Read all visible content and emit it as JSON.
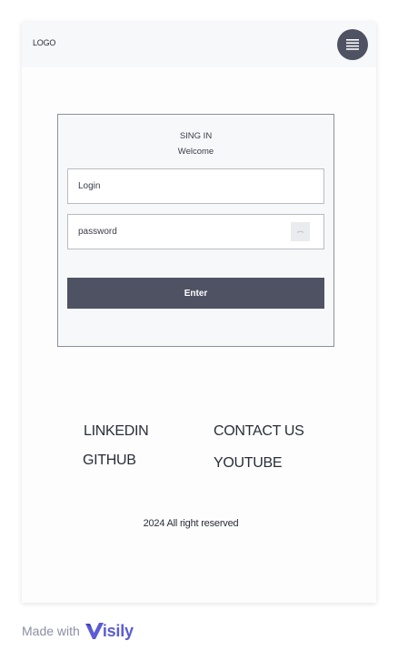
{
  "header": {
    "logo_text": "LOGO",
    "menu_icon": "hamburger-menu-icon"
  },
  "login_form": {
    "title": "SING IN",
    "subtitle": "Welcome",
    "login_placeholder": "Login",
    "password_placeholder": "password",
    "password_toggle_icon": "show-password-icon",
    "enter_label": "Enter"
  },
  "footer_links": {
    "linkedin": "LINKEDIN",
    "github": "GITHUB",
    "contact": "CONTACT US",
    "youtube": "YOUTUBE"
  },
  "copyright": "2024 All right reserved",
  "badge": {
    "made_with": "Made with",
    "brand": "isily",
    "brand_logo_icon": "visily-v-logo-icon"
  },
  "colors": {
    "primary": "#4e5263",
    "brand": "#5b5bd6",
    "header_bg": "#f7f8f9",
    "text": "#2b2e38"
  }
}
